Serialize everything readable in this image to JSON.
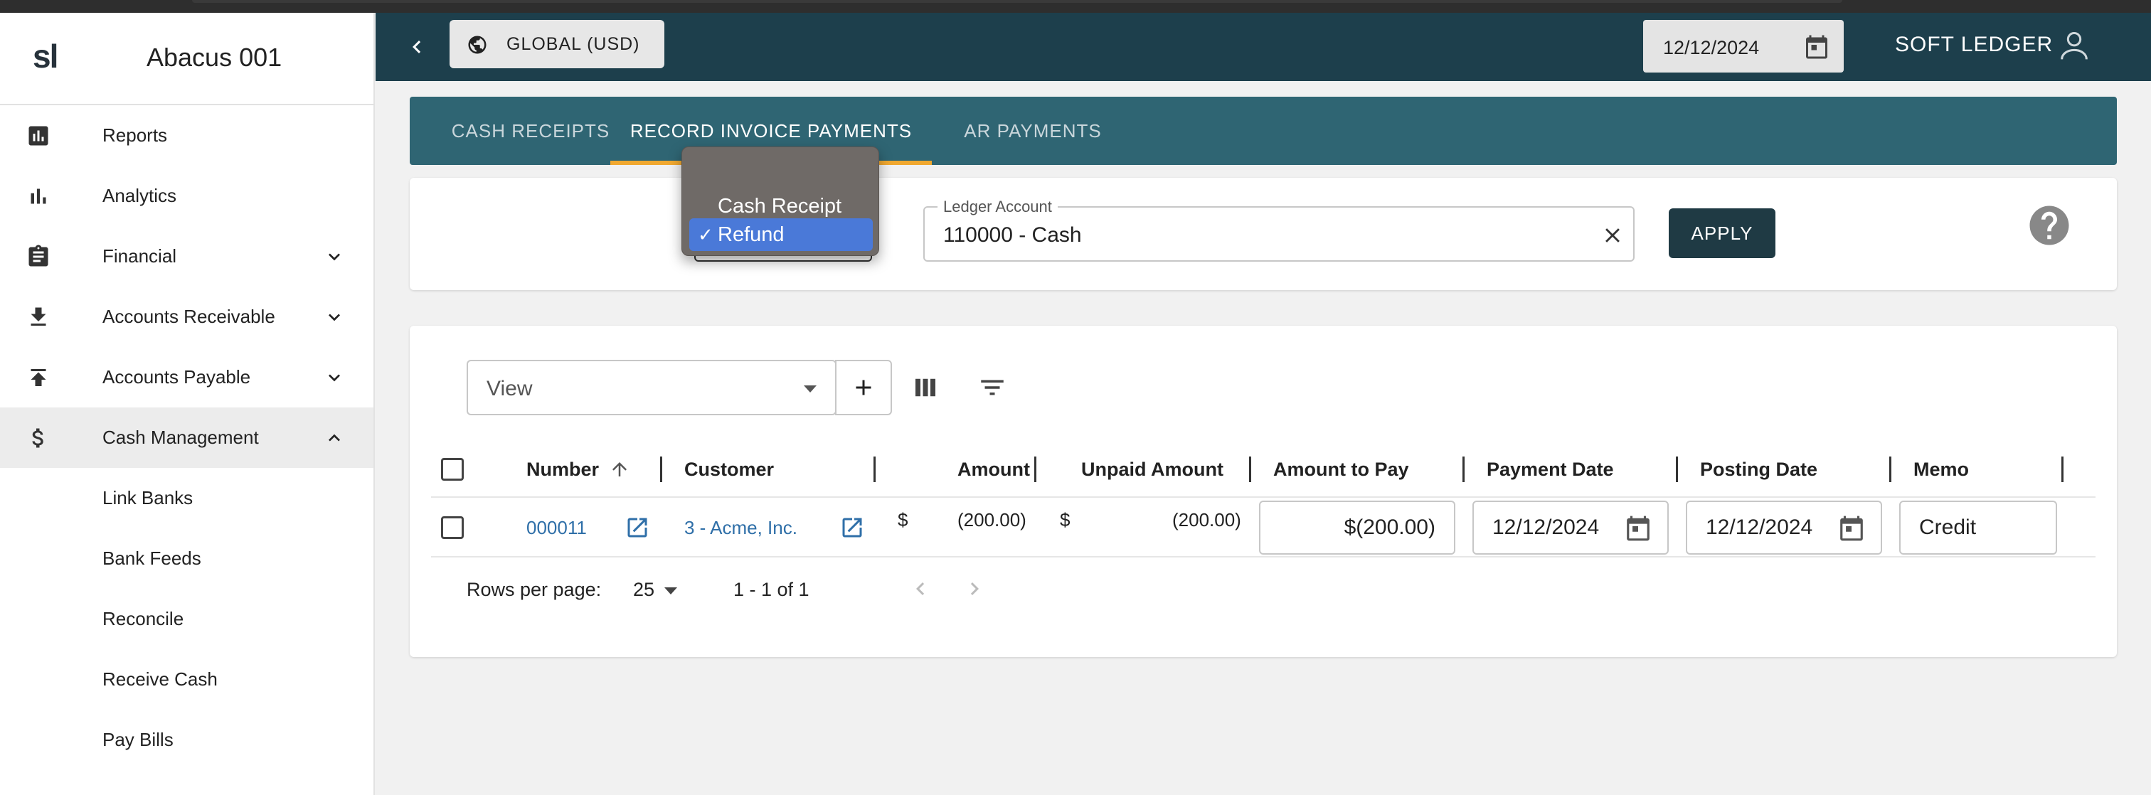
{
  "sidebar": {
    "logo": "sl",
    "org_name": "Abacus 001",
    "items": [
      {
        "label": "Reports"
      },
      {
        "label": "Analytics"
      },
      {
        "label": "Financial"
      },
      {
        "label": "Accounts Receivable"
      },
      {
        "label": "Accounts Payable"
      },
      {
        "label": "Cash Management"
      }
    ],
    "sub_items": [
      {
        "label": "Link Banks"
      },
      {
        "label": "Bank Feeds"
      },
      {
        "label": "Reconcile"
      },
      {
        "label": "Receive Cash"
      },
      {
        "label": "Pay Bills"
      }
    ]
  },
  "header": {
    "global_label": "GLOBAL (USD)",
    "date": "12/12/2024",
    "user_name": "SOFT LEDGER"
  },
  "tabs": [
    {
      "label": "CASH RECEIPTS",
      "active": false
    },
    {
      "label": "RECORD INVOICE PAYMENTS",
      "active": true
    },
    {
      "label": "AR PAYMENTS",
      "active": false
    }
  ],
  "filter": {
    "type_options": [
      "Cash Receipt",
      "Refund"
    ],
    "type_selected": "Refund",
    "check_mark": "✓",
    "ledger_label": "Ledger Account",
    "ledger_value": "110000 - Cash",
    "apply_label": "APPLY"
  },
  "table": {
    "view_placeholder": "View",
    "columns": [
      "Number",
      "Customer",
      "Amount",
      "Unpaid Amount",
      "Amount to Pay",
      "Payment Date",
      "Posting Date",
      "Memo"
    ],
    "rows": [
      {
        "number": "000011",
        "customer": "3 - Acme, Inc.",
        "amount_currency": "$",
        "amount": "(200.00)",
        "unpaid_currency": "$",
        "unpaid_amount": "(200.00)",
        "amount_to_pay": "$(200.00)",
        "payment_date": "12/12/2024",
        "posting_date": "12/12/2024",
        "memo": "Credit"
      }
    ],
    "pagination": {
      "rows_per_page_label": "Rows per page:",
      "rows_per_page": "25",
      "range": "1 - 1 of 1"
    }
  },
  "colors": {
    "header_bg": "#1d3f4c",
    "tabs_bg": "#2f6573",
    "tab_indicator": "#f0a830",
    "apply_bg": "#1f3a44",
    "link": "#2f6fa8",
    "dropdown_highlight": "#4a79d8"
  }
}
